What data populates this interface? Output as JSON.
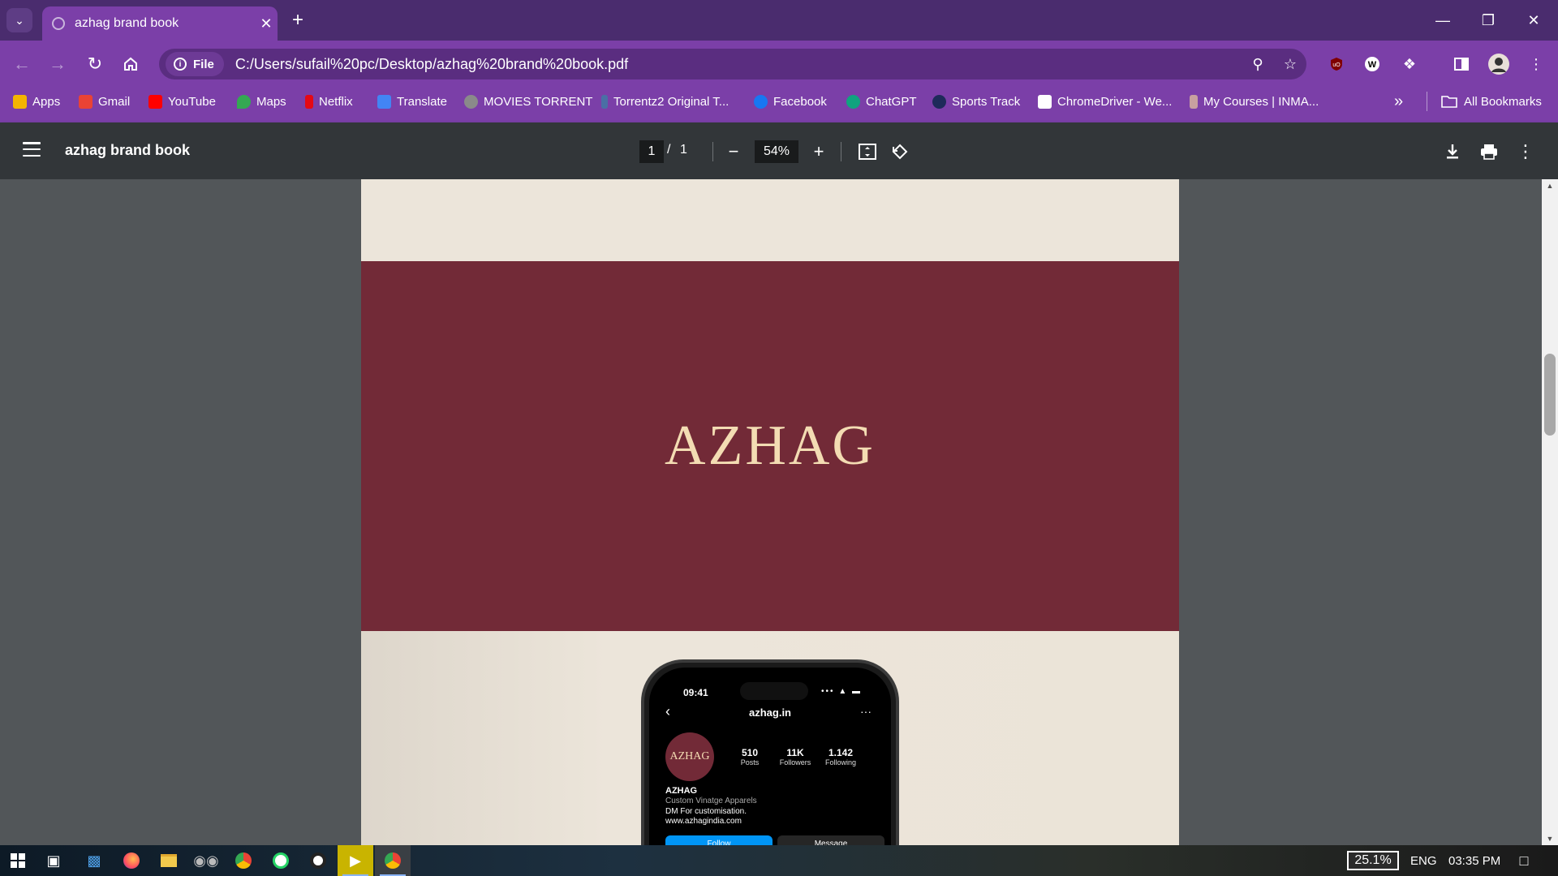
{
  "browser": {
    "tab_title": "azhag brand book",
    "url": "C:/Users/sufail%20pc/Desktop/azhag%20brand%20book.pdf",
    "file_chip": "File",
    "bookmarks": [
      {
        "label": "Apps",
        "icon": "apps-grid-icon",
        "color": "#f4b400"
      },
      {
        "label": "Gmail",
        "icon": "gmail-icon",
        "color": "#ea4335"
      },
      {
        "label": "YouTube",
        "icon": "youtube-icon",
        "color": "#ff0000"
      },
      {
        "label": "Maps",
        "icon": "maps-pin-icon",
        "color": "#34a853"
      },
      {
        "label": "Netflix",
        "icon": "netflix-icon",
        "color": "#e50914"
      },
      {
        "label": "Translate",
        "icon": "translate-icon",
        "color": "#4285f4"
      },
      {
        "label": "MOVIES TORRENT",
        "icon": "torrent-icon",
        "color": "#8a8a8a"
      },
      {
        "label": "Torrentz2 Original T...",
        "icon": "torrentz-icon",
        "color": "#4a6fa5"
      },
      {
        "label": "Facebook",
        "icon": "facebook-icon",
        "color": "#1877f2"
      },
      {
        "label": "ChatGPT",
        "icon": "chatgpt-icon",
        "color": "#10a37f"
      },
      {
        "label": "Sports Track",
        "icon": "sports-track-icon",
        "color": "#1e2a5a"
      },
      {
        "label": "ChromeDriver - We...",
        "icon": "chromedriver-icon",
        "color": "#ffffff"
      },
      {
        "label": "My Courses | INMA...",
        "icon": "courses-icon",
        "color": "#c8a0a0"
      }
    ],
    "all_bookmarks": "All Bookmarks"
  },
  "pdf": {
    "title": "azhag brand book",
    "page_current": "1",
    "page_sep": "/",
    "page_total": "1",
    "zoom": "54%"
  },
  "document": {
    "brand_name": "AZHAG",
    "band_color": "#722a37",
    "phone": {
      "time": "09:41",
      "username": "azhag.in",
      "avatar_text": "AZHAG",
      "stats": [
        {
          "value": "510",
          "label": "Posts"
        },
        {
          "value": "11K",
          "label": "Followers"
        },
        {
          "value": "1.142",
          "label": "Following"
        }
      ],
      "name": "AZHAG",
      "category": "Custom Vinatge Apparels",
      "bio_line1": "DM For customisation.",
      "bio_line2": "www.azhagindia.com",
      "follow": "Follow",
      "message": "Message"
    }
  },
  "taskbar": {
    "battery": "25.1%",
    "language": "ENG",
    "time": "03:35 PM"
  }
}
